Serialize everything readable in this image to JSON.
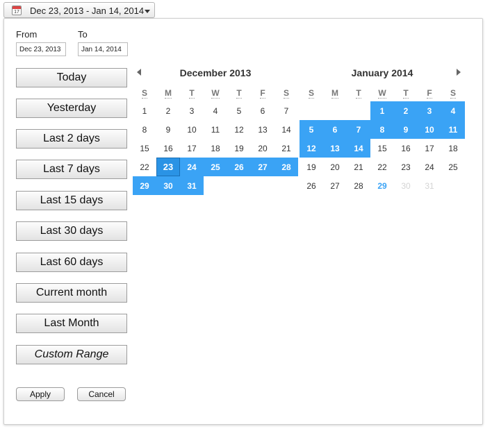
{
  "trigger": {
    "icon": "calendar-icon",
    "icon_number": "17",
    "label": "Dec 23, 2013 - Jan 14, 2014"
  },
  "from": {
    "label": "From",
    "value": "Dec 23, 2013"
  },
  "to": {
    "label": "To",
    "value": "Jan 14, 2014"
  },
  "ranges": [
    "Today",
    "Yesterday",
    "Last 2 days",
    "Last 7 days",
    "Last 15 days",
    "Last 30 days",
    "Last 60 days",
    "Current month",
    "Last Month",
    "Custom Range"
  ],
  "actions": {
    "apply": "Apply",
    "cancel": "Cancel"
  },
  "weekdays": [
    "S",
    "M",
    "T",
    "W",
    "T",
    "F",
    "S"
  ],
  "selection_color": "#3aa3f5",
  "calendars": [
    {
      "title": "December 2013",
      "weeks": [
        [
          {
            "d": "1"
          },
          {
            "d": "2"
          },
          {
            "d": "3"
          },
          {
            "d": "4"
          },
          {
            "d": "5"
          },
          {
            "d": "6"
          },
          {
            "d": "7"
          }
        ],
        [
          {
            "d": "8"
          },
          {
            "d": "9"
          },
          {
            "d": "10"
          },
          {
            "d": "11"
          },
          {
            "d": "12"
          },
          {
            "d": "13"
          },
          {
            "d": "14"
          }
        ],
        [
          {
            "d": "15"
          },
          {
            "d": "16"
          },
          {
            "d": "17"
          },
          {
            "d": "18"
          },
          {
            "d": "19"
          },
          {
            "d": "20"
          },
          {
            "d": "21"
          }
        ],
        [
          {
            "d": "22"
          },
          {
            "d": "23",
            "s": "start"
          },
          {
            "d": "24",
            "s": "sel"
          },
          {
            "d": "25",
            "s": "sel"
          },
          {
            "d": "26",
            "s": "sel"
          },
          {
            "d": "27",
            "s": "sel"
          },
          {
            "d": "28",
            "s": "sel"
          }
        ],
        [
          {
            "d": "29",
            "s": "sel"
          },
          {
            "d": "30",
            "s": "sel"
          },
          {
            "d": "31",
            "s": "sel"
          },
          {
            "d": ""
          },
          {
            "d": ""
          },
          {
            "d": ""
          },
          {
            "d": ""
          }
        ]
      ]
    },
    {
      "title": "January 2014",
      "weeks": [
        [
          {
            "d": ""
          },
          {
            "d": ""
          },
          {
            "d": ""
          },
          {
            "d": "1",
            "s": "sel"
          },
          {
            "d": "2",
            "s": "sel"
          },
          {
            "d": "3",
            "s": "sel"
          },
          {
            "d": "4",
            "s": "sel"
          }
        ],
        [
          {
            "d": "5",
            "s": "sel"
          },
          {
            "d": "6",
            "s": "sel"
          },
          {
            "d": "7",
            "s": "sel"
          },
          {
            "d": "8",
            "s": "sel"
          },
          {
            "d": "9",
            "s": "sel"
          },
          {
            "d": "10",
            "s": "sel"
          },
          {
            "d": "11",
            "s": "sel"
          }
        ],
        [
          {
            "d": "12",
            "s": "sel"
          },
          {
            "d": "13",
            "s": "sel"
          },
          {
            "d": "14",
            "s": "sel"
          },
          {
            "d": "15"
          },
          {
            "d": "16"
          },
          {
            "d": "17"
          },
          {
            "d": "18"
          }
        ],
        [
          {
            "d": "19"
          },
          {
            "d": "20"
          },
          {
            "d": "21"
          },
          {
            "d": "22"
          },
          {
            "d": "23"
          },
          {
            "d": "24"
          },
          {
            "d": "25"
          }
        ],
        [
          {
            "d": "26"
          },
          {
            "d": "27"
          },
          {
            "d": "28"
          },
          {
            "d": "29",
            "s": "today"
          },
          {
            "d": "30",
            "s": "future"
          },
          {
            "d": "31",
            "s": "future"
          },
          {
            "d": ""
          }
        ]
      ]
    }
  ]
}
